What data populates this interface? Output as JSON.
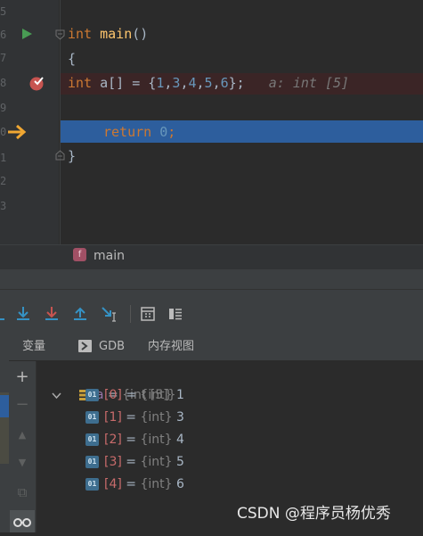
{
  "editor": {
    "line_numbers": [
      "5",
      "6",
      "7",
      "8",
      "9",
      "0",
      "1",
      "2",
      "3"
    ],
    "code": {
      "kw_int": "int",
      "fn_main": "main",
      "paren": "()",
      "brace_open": "{",
      "a_decl_var": "a[] = {",
      "nums": [
        "1",
        "3",
        "4",
        "5",
        "6"
      ],
      "a_decl_end": "};",
      "inline_value": "a: int [5]",
      "kw_return": "return",
      "return_val": "0",
      "semicolon": ";",
      "brace_close": "}"
    }
  },
  "breadcrumb": {
    "fn_icon": "f",
    "label": "main"
  },
  "debug_toolbar": {
    "icons": [
      "step-over-icon",
      "step-into-icon",
      "force-step-into-icon",
      "step-out-icon",
      "run-to-cursor-icon",
      "evaluate-icon",
      "layout-icon"
    ]
  },
  "tabs": [
    {
      "label": "变量"
    },
    {
      "label": "GDB"
    },
    {
      "label": "内存视图"
    }
  ],
  "variables": {
    "root": {
      "name": "a",
      "eq": " = ",
      "type": "{int [5]}"
    },
    "items": [
      {
        "name": "[0]",
        "eq": " = ",
        "type": "{int}",
        "value": " 1"
      },
      {
        "name": "[1]",
        "eq": " = ",
        "type": "{int}",
        "value": " 3"
      },
      {
        "name": "[2]",
        "eq": " = ",
        "type": "{int}",
        "value": " 4"
      },
      {
        "name": "[3]",
        "eq": " = ",
        "type": "{int}",
        "value": " 5"
      },
      {
        "name": "[4]",
        "eq": " = ",
        "type": "{int}",
        "value": " 6"
      }
    ],
    "icon_label": "01"
  },
  "side_buttons": [
    "+",
    "−",
    "▲",
    "▼",
    "⧉",
    "∞"
  ],
  "watermark": "CSDN @程序员杨优秀",
  "colors": {
    "breakpoint_row": "#3b2526",
    "current_line": "#2d5e9d",
    "keyword": "#cc7832",
    "function": "#ffc66d",
    "number": "#6897bb"
  }
}
